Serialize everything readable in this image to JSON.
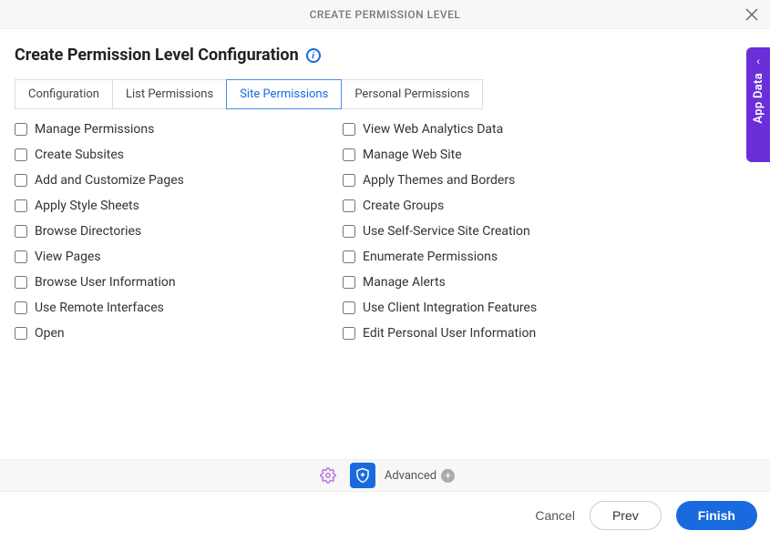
{
  "titlebar": {
    "title": "CREATE PERMISSION LEVEL"
  },
  "header": {
    "title": "Create Permission Level Configuration"
  },
  "tabs": [
    {
      "label": "Configuration",
      "active": false
    },
    {
      "label": "List Permissions",
      "active": false
    },
    {
      "label": "Site Permissions",
      "active": true
    },
    {
      "label": "Personal Permissions",
      "active": false
    }
  ],
  "permissions": {
    "left": [
      {
        "label": "Manage Permissions"
      },
      {
        "label": "Create Subsites"
      },
      {
        "label": "Add and Customize Pages"
      },
      {
        "label": "Apply Style Sheets"
      },
      {
        "label": "Browse Directories"
      },
      {
        "label": "View Pages"
      },
      {
        "label": "Browse User Information"
      },
      {
        "label": "Use Remote Interfaces"
      },
      {
        "label": "Open"
      }
    ],
    "right": [
      {
        "label": "View Web Analytics Data"
      },
      {
        "label": "Manage Web Site"
      },
      {
        "label": "Apply Themes and Borders"
      },
      {
        "label": "Create Groups"
      },
      {
        "label": "Use Self-Service Site Creation"
      },
      {
        "label": "Enumerate Permissions"
      },
      {
        "label": "Manage Alerts"
      },
      {
        "label": "Use Client Integration Features"
      },
      {
        "label": "Edit Personal User Information"
      }
    ]
  },
  "footer": {
    "advanced_label": "Advanced"
  },
  "actions": {
    "cancel": "Cancel",
    "prev": "Prev",
    "finish": "Finish"
  },
  "side": {
    "label": "App Data"
  }
}
